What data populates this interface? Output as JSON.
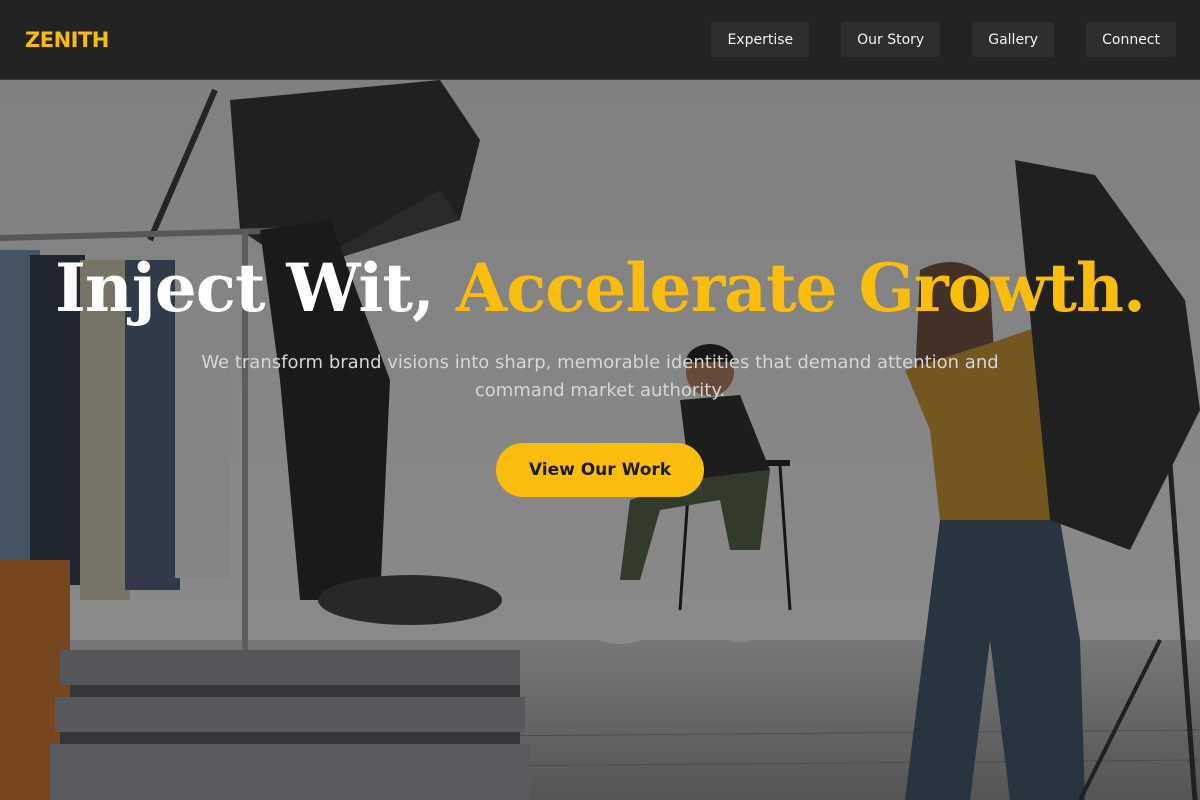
{
  "brand": {
    "logo_text": "ZENITH",
    "accent_color": "#fbbd0d"
  },
  "nav": {
    "items": [
      {
        "label": "Expertise"
      },
      {
        "label": "Our Story"
      },
      {
        "label": "Gallery"
      },
      {
        "label": "Connect"
      }
    ]
  },
  "hero": {
    "headline_part1": "Inject Wit, ",
    "headline_part2": "Accelerate Growth.",
    "subheadline": "We transform brand visions into sharp, memorable identities that demand attention and command market authority.",
    "cta_label": "View Our Work",
    "background_image": "photo studio shoot: clothing rack, softbox lights, seated model, photographer in yellow sweater"
  }
}
